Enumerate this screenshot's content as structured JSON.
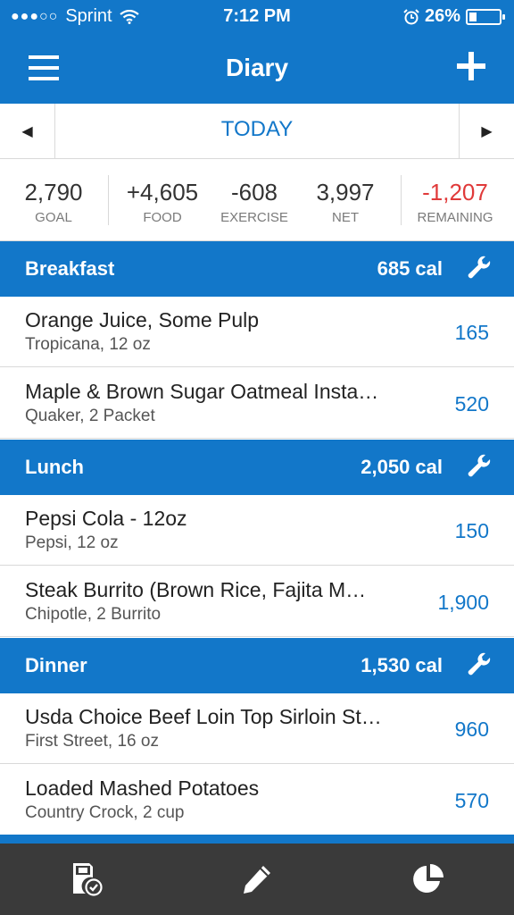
{
  "status_bar": {
    "signal": "●●●○○",
    "carrier": "Sprint",
    "time": "7:12 PM",
    "battery": "26%",
    "battery_level": 0.26
  },
  "nav": {
    "title": "Diary"
  },
  "date_nav": {
    "label": "TODAY",
    "prev": "◀",
    "next": "▶"
  },
  "summary": {
    "goal": {
      "value": "2,790",
      "label": "GOAL"
    },
    "food": {
      "value": "+4,605",
      "label": "FOOD"
    },
    "exercise": {
      "value": "-608",
      "label": "EXERCISE"
    },
    "net": {
      "value": "3,997",
      "label": "NET"
    },
    "remaining": {
      "value": "-1,207",
      "label": "REMAINING"
    }
  },
  "meals": [
    {
      "name": "Breakfast",
      "calories": "685 cal",
      "items": [
        {
          "name": "Orange Juice, Some Pulp",
          "desc": "Tropicana, 12 oz",
          "cal": "165"
        },
        {
          "name": "Maple & Brown Sugar Oatmeal Insta…",
          "desc": "Quaker, 2 Packet",
          "cal": "520"
        }
      ]
    },
    {
      "name": "Lunch",
      "calories": "2,050 cal",
      "items": [
        {
          "name": "Pepsi Cola - 12oz",
          "desc": "Pepsi, 12 oz",
          "cal": "150"
        },
        {
          "name": "Steak Burrito (Brown Rice, Fajita M…",
          "desc": "Chipotle, 2 Burrito",
          "cal": "1,900"
        }
      ]
    },
    {
      "name": "Dinner",
      "calories": "1,530 cal",
      "items": [
        {
          "name": "Usda Choice Beef Loin Top Sirloin St…",
          "desc": "First Street, 16 oz",
          "cal": "960"
        },
        {
          "name": "Loaded Mashed Potatoes",
          "desc": "Country Crock, 2 cup",
          "cal": "570"
        }
      ]
    }
  ],
  "colors": {
    "brand_blue": "#1277C9",
    "negative_red": "#E03A3A",
    "tabbar": "#3a3a3a"
  },
  "icons": {
    "menu": "hamburger-icon",
    "add": "plus-icon",
    "wrench": "wrench-icon",
    "tab_diary": "diary-check-icon",
    "tab_edit": "pencil-icon",
    "tab_reports": "pie-chart-icon"
  }
}
